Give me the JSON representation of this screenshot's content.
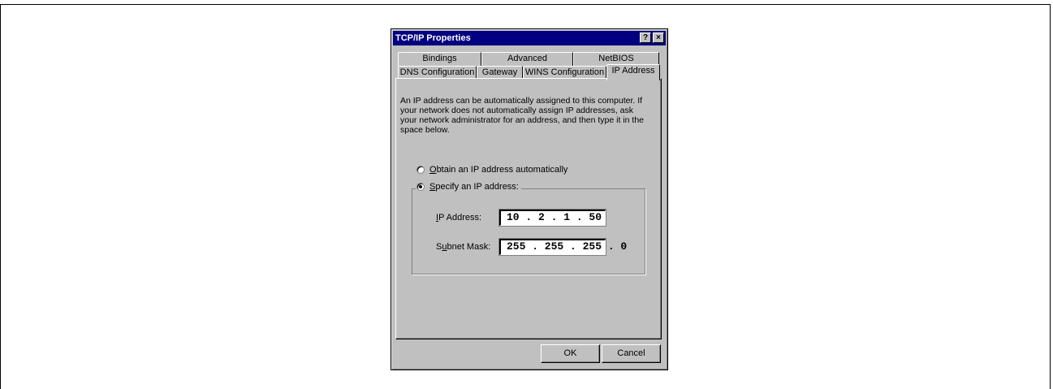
{
  "window": {
    "title": "TCP/IP Properties",
    "help_glyph": "?",
    "close_glyph": "×"
  },
  "tabs_back": [
    "Bindings",
    "Advanced",
    "NetBIOS"
  ],
  "tabs_front": [
    "DNS Configuration",
    "Gateway",
    "WINS Configuration",
    "IP Address"
  ],
  "description": "An IP address can be automatically assigned to this computer. If your network does not automatically assign IP addresses, ask your network administrator for an address, and then type it in the space below.",
  "options": {
    "obtain": {
      "accel": "O",
      "rest": "btain an IP address automatically",
      "selected": false
    },
    "specify": {
      "accel": "S",
      "rest": "pecify an IP address:",
      "selected": true
    }
  },
  "fields": {
    "ip_label_accel": "I",
    "ip_label_rest": "P Address:",
    "ip_value": "10 . 2 . 1 . 50",
    "mask_label_pre": "S",
    "mask_label_accel": "u",
    "mask_label_rest": "bnet Mask:",
    "mask_value": "255 . 255 . 255 . 0"
  },
  "buttons": {
    "ok": "OK",
    "cancel": "Cancel"
  }
}
